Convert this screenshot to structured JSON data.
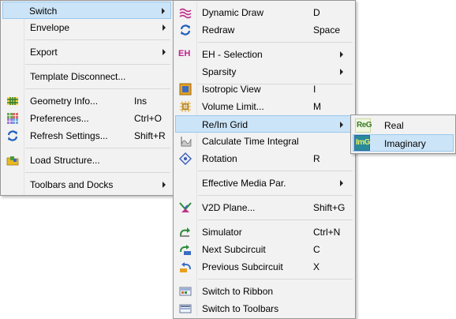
{
  "menu1": {
    "items": [
      {
        "label": "Switch"
      },
      {
        "label": "Envelope"
      },
      {
        "label": "Export"
      },
      {
        "label": "Template Disconnect..."
      },
      {
        "label": "Geometry Info...",
        "shortcut": "Ins",
        "icon": "geometry-grid-icon"
      },
      {
        "label": "Preferences...",
        "shortcut": "Ctrl+O",
        "icon": "preferences-icon"
      },
      {
        "label": "Refresh Settings...",
        "shortcut": "Shift+R",
        "icon": "refresh-icon"
      },
      {
        "label": "Load Structure...",
        "icon": "load-structure-icon"
      },
      {
        "label": "Toolbars and Docks"
      }
    ]
  },
  "menu2": {
    "items": [
      {
        "label": "Dynamic Draw",
        "shortcut": "D",
        "icon": "dynamic-draw-icon"
      },
      {
        "label": "Redraw",
        "shortcut": "Space",
        "icon": "redraw-icon"
      },
      {
        "label": "EH - Selection",
        "icon": "eh-selection-icon",
        "icon_text": "EH"
      },
      {
        "label": "Sparsity"
      },
      {
        "label": "Isotropic View",
        "shortcut": "I",
        "icon": "isotropic-view-icon"
      },
      {
        "label": "Volume Limit...",
        "shortcut": "M",
        "icon": "volume-limit-icon"
      },
      {
        "label": "Re/Im Grid"
      },
      {
        "label": "Calculate Time Integral",
        "icon": "time-integral-icon"
      },
      {
        "label": "Rotation",
        "shortcut": "R",
        "icon": "rotation-icon"
      },
      {
        "label": "Effective Media Par."
      },
      {
        "label": "V2D Plane...",
        "shortcut": "Shift+G",
        "icon": "v2d-plane-icon"
      },
      {
        "label": "Simulator",
        "shortcut": "Ctrl+N",
        "icon": "simulator-icon"
      },
      {
        "label": "Next Subcircuit",
        "shortcut": "C",
        "icon": "next-subcircuit-icon"
      },
      {
        "label": "Previous Subcircuit",
        "shortcut": "X",
        "icon": "previous-subcircuit-icon"
      },
      {
        "label": "Switch to Ribbon",
        "icon": "ribbon-icon"
      },
      {
        "label": "Switch to Toolbars",
        "icon": "toolbars-icon"
      }
    ]
  },
  "menu3": {
    "items": [
      {
        "label": "Real",
        "icon": "real-grid-icon",
        "icon_text": "ReG"
      },
      {
        "label": "Imaginary",
        "icon": "imaginary-grid-icon",
        "icon_text": "ImG"
      }
    ]
  },
  "colors": {
    "menu_bg": "#f2f2f2",
    "highlight_bg": "#cce4f7",
    "highlight_border": "#99c8ed",
    "separator": "#d7d7d7"
  }
}
